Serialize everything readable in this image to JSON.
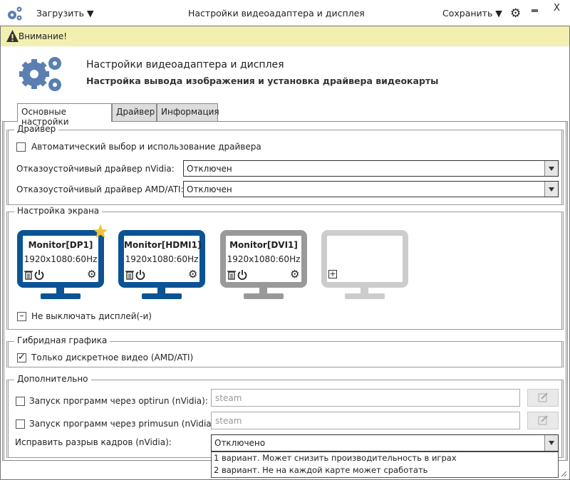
{
  "titlebar": {
    "load_label": "Загрузить",
    "title": "Настройки видеоадаптера и дисплея",
    "save_label": "Сохранить",
    "minimize": "–",
    "close": "X"
  },
  "warning": {
    "text": "Внимание!"
  },
  "header": {
    "title": "Настройки видеоадаптера и дисплея",
    "subtitle": "Настройка вывода изображения и установка драйвера видеокарты"
  },
  "tabs": [
    {
      "label": "Основные настройки",
      "active": true
    },
    {
      "label": "Драйвер"
    },
    {
      "label": "Информация"
    }
  ],
  "driver": {
    "legend": "Драйвер",
    "auto_label": "Автоматический выбор и использование драйвера",
    "auto_checked": false,
    "nvidia_label": "Отказоустойчивый драйвер nVidia:",
    "nvidia_value": "Отключен",
    "amd_label": "Отказоустойчивый драйвер AMD/ATI:",
    "amd_value": "Отключен"
  },
  "screen": {
    "legend": "Настройка экрана",
    "monitors": [
      {
        "name": "Monitor[DP1]",
        "mode": "1920x1080:60Hz",
        "color": "#0b5394",
        "primary": true
      },
      {
        "name": "Monitor[HDMI1]",
        "mode": "1920x1080:60Hz",
        "color": "#0b5394"
      },
      {
        "name": "Monitor[DVI1]",
        "mode": "1920x1080:60Hz",
        "color": "#999999"
      },
      {
        "name": "",
        "mode": "",
        "color": "#cccccc",
        "empty": true
      }
    ],
    "keep_on_label": "Не выключать дисплей(-и)"
  },
  "hybrid": {
    "legend": "Гибридная графика",
    "discrete_label": "Только дискретное видео (AMD/ATI)",
    "discrete_checked": true
  },
  "extra": {
    "legend": "Дополнительно",
    "optirun_label": "Запуск программ через optirun (nVidia):",
    "optirun_placeholder": "steam",
    "primusun_label": "Запуск программ через primusun (nVidia):",
    "primusun_placeholder": "steam",
    "tearing_label": "Исправить разрыв кадров (nVidia):",
    "tearing_value": "Отключено",
    "tearing_options": [
      "1 вариант. Может снизить производительность в играх",
      "2 вариант. Не на каждой карте может сработать"
    ]
  },
  "colors": {
    "accent": "#5a7fb0",
    "warning_bg": "#f2efb0",
    "monitor_active": "#0b5394",
    "star": "#f2c232"
  }
}
